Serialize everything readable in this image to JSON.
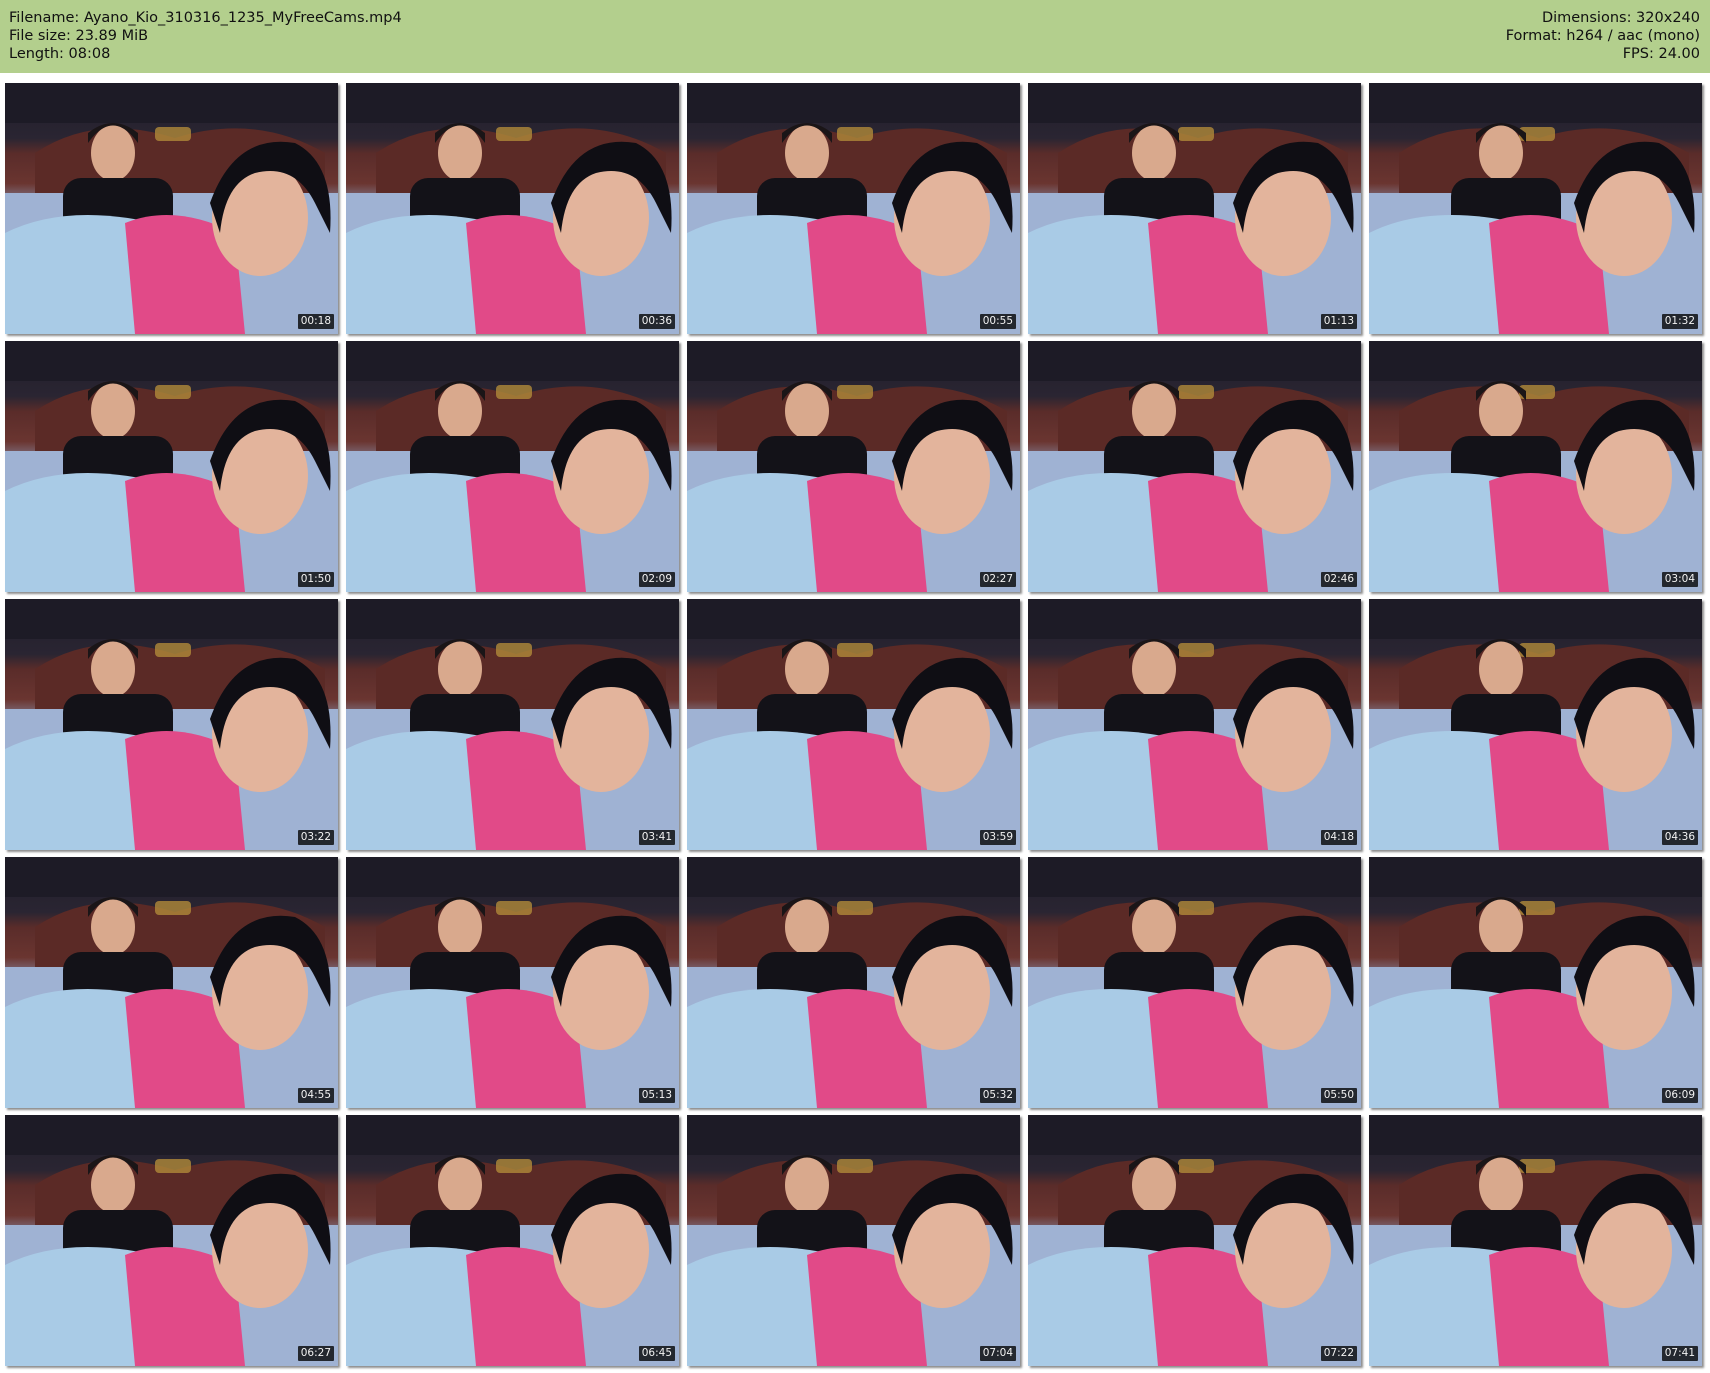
{
  "header": {
    "left": [
      "Filename: Ayano_Kio_310316_1235_MyFreeCams.mp4",
      "File size: 23.89 MiB",
      "Length: 08:08"
    ],
    "right": [
      "Dimensions: 320x240",
      "Format: h264 / aac (mono)",
      "FPS: 24.00"
    ]
  },
  "colors": {
    "header_bg": "#b3cf8d",
    "page_bg": "#ffffff"
  },
  "thumbnails": [
    {
      "time": "00:18"
    },
    {
      "time": "00:36"
    },
    {
      "time": "00:55"
    },
    {
      "time": "01:13"
    },
    {
      "time": "01:32"
    },
    {
      "time": "01:50"
    },
    {
      "time": "02:09"
    },
    {
      "time": "02:27"
    },
    {
      "time": "02:46"
    },
    {
      "time": "03:04"
    },
    {
      "time": "03:22"
    },
    {
      "time": "03:41"
    },
    {
      "time": "03:59"
    },
    {
      "time": "04:18"
    },
    {
      "time": "04:36"
    },
    {
      "time": "04:55"
    },
    {
      "time": "05:13"
    },
    {
      "time": "05:32"
    },
    {
      "time": "05:50"
    },
    {
      "time": "06:09"
    },
    {
      "time": "06:27"
    },
    {
      "time": "06:45"
    },
    {
      "time": "07:04"
    },
    {
      "time": "07:22"
    },
    {
      "time": "07:41"
    }
  ]
}
